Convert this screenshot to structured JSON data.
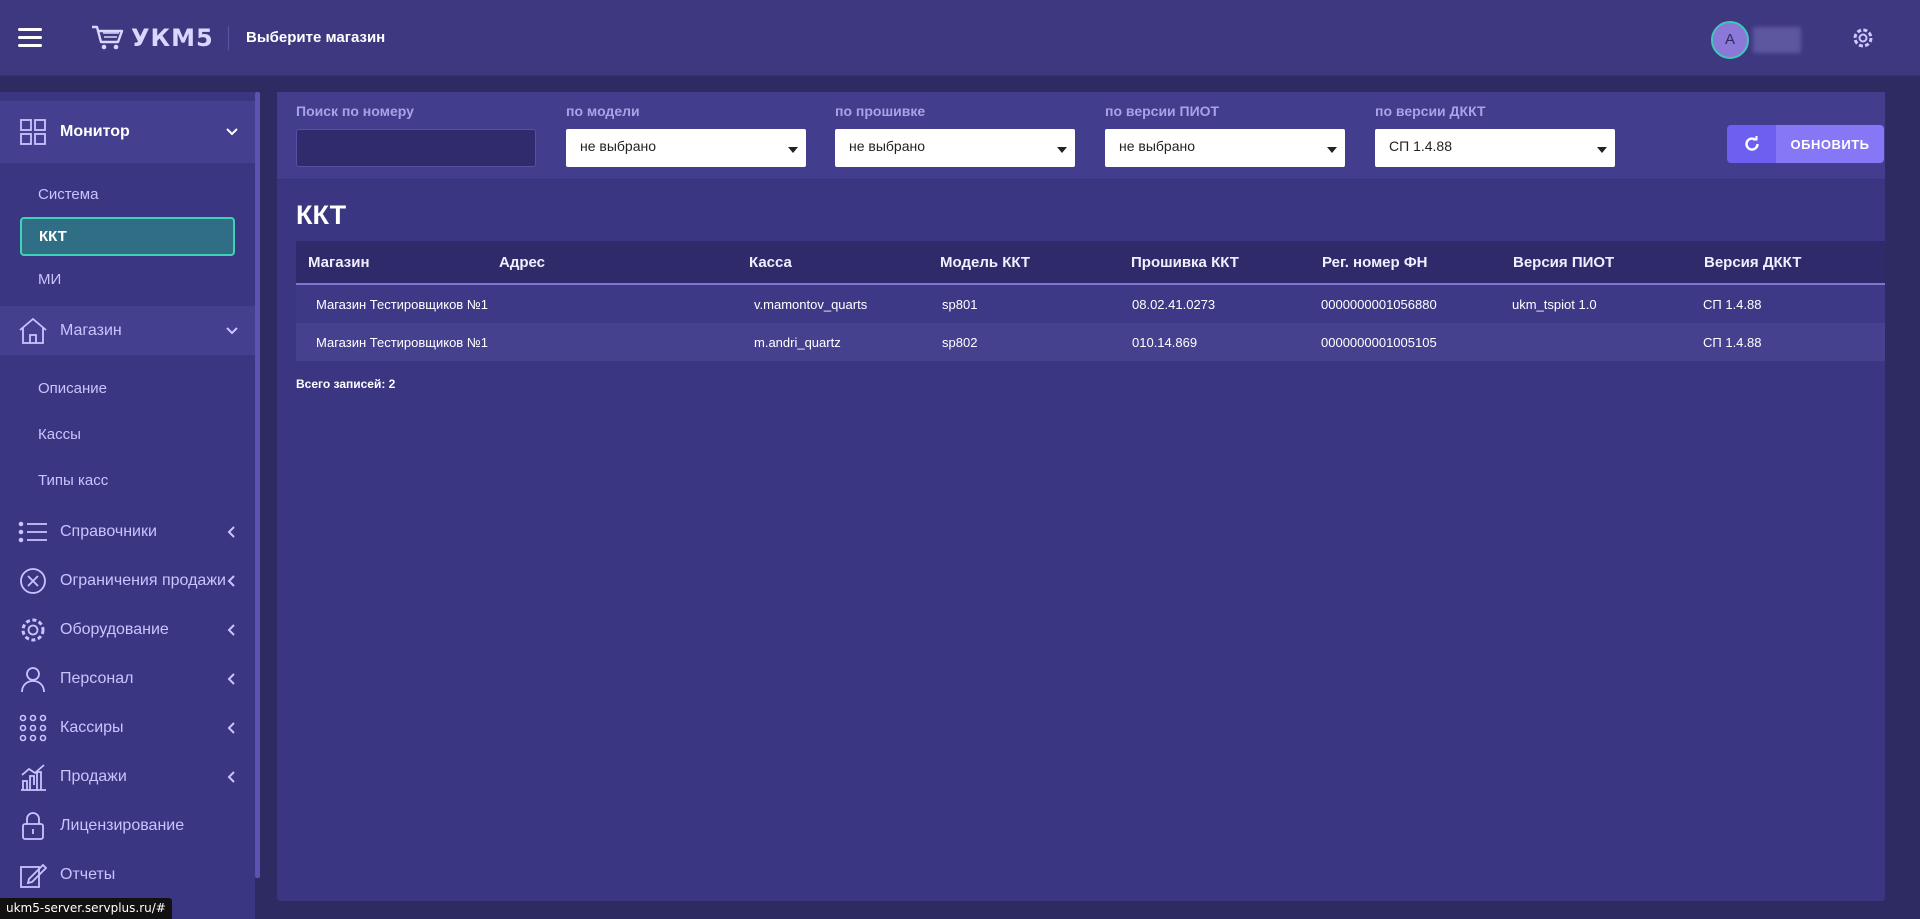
{
  "header": {
    "logo_text": "УКМ5",
    "store_select": "Выберите магазин",
    "avatar_initial": "А"
  },
  "sidebar": {
    "groups": [
      {
        "label": "Монитор",
        "icon": "grid-icon",
        "expanded": true,
        "items": [
          {
            "label": "Система"
          },
          {
            "label": "ККТ",
            "selected": true
          },
          {
            "label": "МИ"
          }
        ]
      },
      {
        "label": "Магазин",
        "icon": "home-icon",
        "expanded": true,
        "items": [
          {
            "label": "Описание"
          },
          {
            "label": "Кассы"
          },
          {
            "label": "Типы касс"
          }
        ]
      },
      {
        "label": "Справочники",
        "icon": "list-icon"
      },
      {
        "label": "Ограничения продажи",
        "icon": "circle-x-icon"
      },
      {
        "label": "Оборудование",
        "icon": "gear-icon"
      },
      {
        "label": "Персонал",
        "icon": "person-icon"
      },
      {
        "label": "Кассиры",
        "icon": "dots-grid-icon"
      },
      {
        "label": "Продажи",
        "icon": "chart-icon"
      },
      {
        "label": "Лицензирование",
        "icon": "lock-icon"
      },
      {
        "label": "Отчеты",
        "icon": "report-icon"
      }
    ]
  },
  "filters": {
    "search_label": "Поиск по номеру",
    "search_value": "",
    "model_label": "по модели",
    "model_value": "не выбрано",
    "firmware_label": "по прошивке",
    "firmware_value": "не выбрано",
    "piot_label": "по версии ПИОТ",
    "piot_value": "не выбрано",
    "dkkt_label": "по версии ДККТ",
    "dkkt_value": "СП 1.4.88",
    "refresh_label": "ОБНОВИТЬ"
  },
  "main": {
    "title": "ККТ",
    "columns": [
      "Магазин",
      "Адрес",
      "Касса",
      "Модель ККТ",
      "Прошивка ККТ",
      "Рег. номер ФН",
      "Версия ПИОТ",
      "Версия ДККТ"
    ],
    "rows": [
      [
        "Магазин Тестировщиков №1",
        "",
        "v.mamontov_quarts",
        "sp801",
        "08.02.41.0273",
        "0000000001056880",
        "ukm_tspiot 1.0",
        "СП 1.4.88"
      ],
      [
        "Магазин Тестировщиков №1",
        "",
        "m.andri_quartz",
        "sp802",
        "010.14.869",
        "0000000001005105",
        "",
        "СП 1.4.88"
      ]
    ],
    "total": "Всего записей: 2"
  },
  "statusbar": {
    "url": "ukm5-server.servplus.ru/#"
  },
  "colors": {
    "accent": "#8577f5",
    "selected": "#3fd3b5",
    "background": "#2e2b63"
  }
}
